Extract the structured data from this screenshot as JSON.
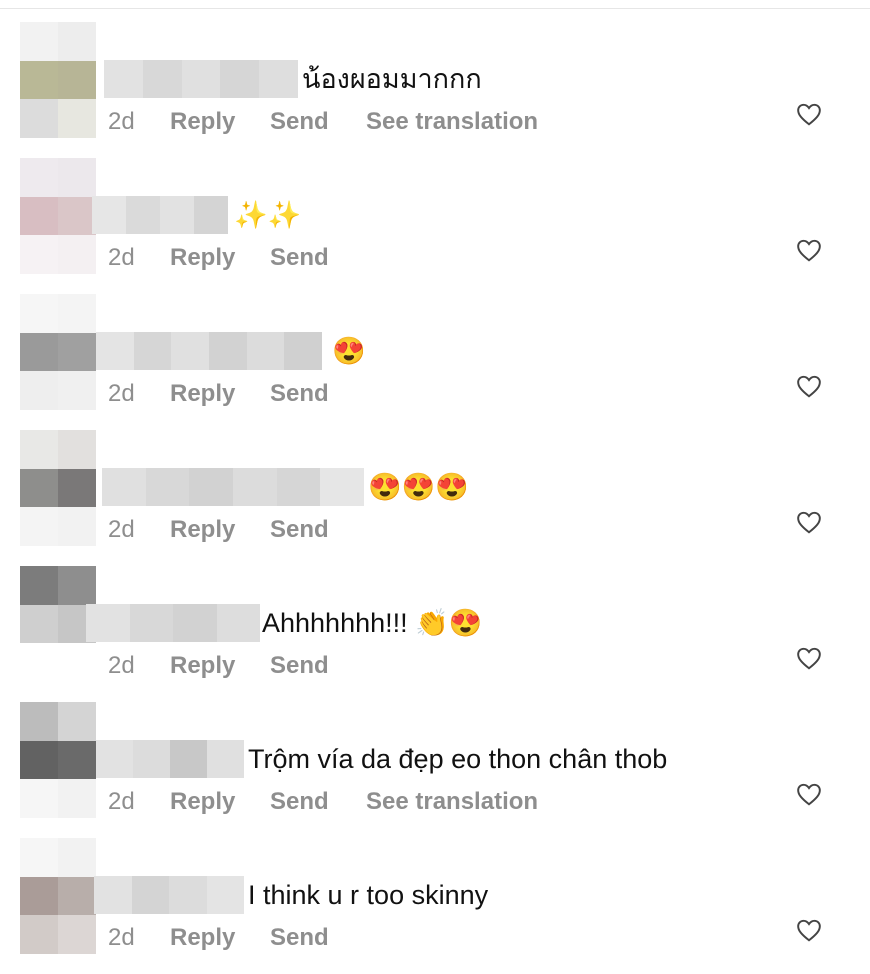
{
  "comments": [
    {
      "text": "น้องผอมมากกก",
      "time": "2d",
      "reply": "Reply",
      "send": "Send",
      "translate": "See translation"
    },
    {
      "text": "✨✨",
      "time": "2d",
      "reply": "Reply",
      "send": "Send",
      "translate": ""
    },
    {
      "text": "😍",
      "time": "2d",
      "reply": "Reply",
      "send": "Send",
      "translate": ""
    },
    {
      "text": "😍😍😍",
      "time": "2d",
      "reply": "Reply",
      "send": "Send",
      "translate": ""
    },
    {
      "text": "Ahhhhhhh!!! 👏😍",
      "time": "2d",
      "reply": "Reply",
      "send": "Send",
      "translate": ""
    },
    {
      "text": "Trộm vía da đẹp eo thon chân thob",
      "time": "2d",
      "reply": "Reply",
      "send": "Send",
      "translate": "See translation"
    },
    {
      "text": "I think u r too skinny",
      "time": "2d",
      "reply": "Reply",
      "send": "Send",
      "translate": ""
    }
  ],
  "icons": {
    "like": "heart-outline-icon"
  }
}
